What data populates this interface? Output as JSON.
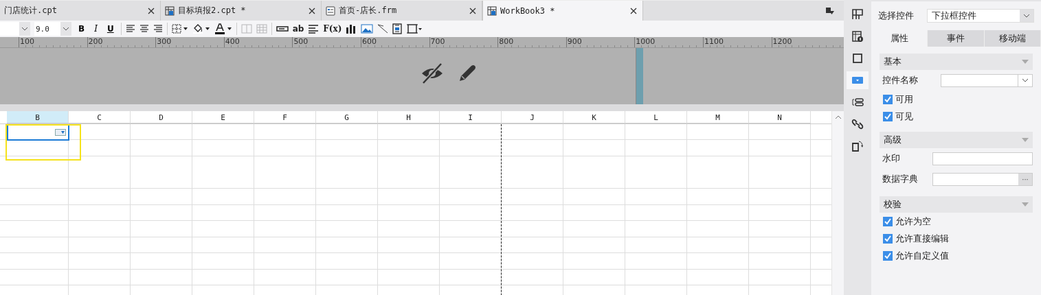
{
  "tabs": [
    {
      "label": "门店统计.cpt",
      "selected": false,
      "kind": "plain"
    },
    {
      "label": "目标填报2.cpt *",
      "selected": false,
      "kind": "report"
    },
    {
      "label": "首页-店长.frm",
      "selected": false,
      "kind": "form"
    },
    {
      "label": "WorkBook3 *",
      "selected": true,
      "kind": "report"
    }
  ],
  "toolbar": {
    "font_size": "9.0",
    "styles": [
      "B",
      "I",
      "U"
    ],
    "insert_text": "ab",
    "formula": "F(x)",
    "merge_buttons": [
      {
        "disabled": true
      },
      {
        "disabled": true
      }
    ]
  },
  "ruler": [
    "100",
    "200",
    "300",
    "400",
    "500",
    "600",
    "700",
    "800",
    "900",
    "1000",
    "1100",
    "1200"
  ],
  "columns": [
    {
      "label": "B",
      "selected": true
    },
    {
      "label": "C",
      "selected": false
    },
    {
      "label": "D",
      "selected": false
    },
    {
      "label": "E",
      "selected": false
    },
    {
      "label": "F",
      "selected": false
    },
    {
      "label": "G",
      "selected": false
    },
    {
      "label": "H",
      "selected": false
    },
    {
      "label": "I",
      "selected": false
    },
    {
      "label": "J",
      "selected": false
    },
    {
      "label": "K",
      "selected": false
    },
    {
      "label": "L",
      "selected": false
    },
    {
      "label": "M",
      "selected": false
    },
    {
      "label": "N",
      "selected": false
    }
  ],
  "side_icons": [
    {
      "kind": "layout",
      "selected": false
    },
    {
      "kind": "cell-info",
      "selected": false
    },
    {
      "kind": "frame",
      "selected": false
    },
    {
      "kind": "widget",
      "selected": true
    },
    {
      "kind": "condition",
      "selected": false
    },
    {
      "kind": "link",
      "selected": false
    },
    {
      "kind": "rotate",
      "selected": false
    }
  ],
  "panel": {
    "select_label": "选择控件",
    "select_value": "下拉框控件",
    "tabs": [
      {
        "label": "属性",
        "selected": true
      },
      {
        "label": "事件",
        "selected": false
      },
      {
        "label": "移动端",
        "selected": false
      }
    ],
    "sections": [
      {
        "title": "基本",
        "items": [
          {
            "kind": "combo",
            "label": "控件名称"
          },
          {
            "kind": "checkbox",
            "label": "可用",
            "checked": true
          },
          {
            "kind": "checkbox",
            "label": "可见",
            "checked": true
          }
        ]
      },
      {
        "title": "高级",
        "items": [
          {
            "kind": "text",
            "label": "水印"
          },
          {
            "kind": "button_field",
            "label": "数据字典",
            "button": "···"
          }
        ]
      },
      {
        "title": "校验",
        "items": [
          {
            "kind": "checkbox",
            "label": "允许为空",
            "checked": true
          },
          {
            "kind": "checkbox",
            "label": "允许直接编辑",
            "checked": true
          },
          {
            "kind": "checkbox",
            "label": "允许自定义值",
            "checked": true
          }
        ]
      }
    ]
  }
}
